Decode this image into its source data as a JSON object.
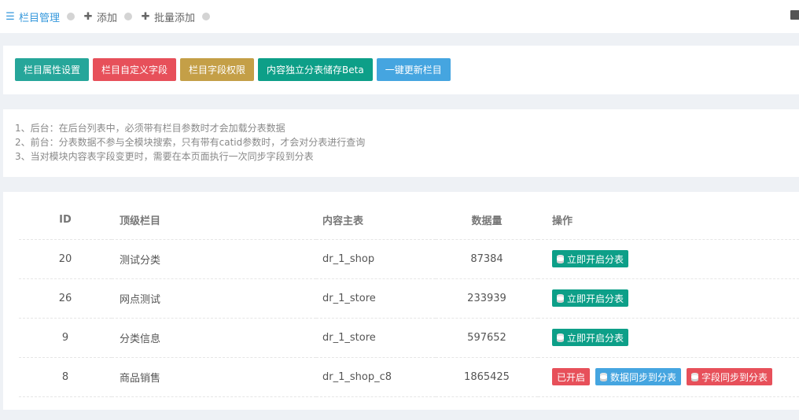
{
  "nav": {
    "items": [
      {
        "icon": "list-icon",
        "glyph": "☰",
        "label": "栏目管理"
      },
      {
        "icon": "plus-icon",
        "glyph": "✚",
        "label": "添加"
      },
      {
        "icon": "plus-icon",
        "glyph": "✚",
        "label": "批量添加"
      }
    ],
    "accent": "#3598dc"
  },
  "actions": {
    "attr_settings": "栏目属性设置",
    "custom_fields": "栏目自定义字段",
    "field_permissions": "栏目字段权限",
    "independent_storage": "内容独立分表储存Beta",
    "one_click_update": "一键更新栏目"
  },
  "notes": [
    "1、后台：在后台列表中，必须带有栏目参数时才会加载分表数据",
    "2、前台：分表数据不参与全模块搜索，只有带有catid参数时，才会对分表进行查询",
    "3、当对模块内容表字段变更时，需要在本页面执行一次同步字段到分表"
  ],
  "table": {
    "headers": {
      "id": "ID",
      "top": "顶级栏目",
      "main": "内容主表",
      "count": "数据量",
      "op": "操作"
    },
    "rows": [
      {
        "id": "20",
        "top": "测试分类",
        "main": "dr_1_shop",
        "count": "87384",
        "btn": "立即开启分表"
      },
      {
        "id": "26",
        "top": "网点测试",
        "main": "dr_1_store",
        "count": "233939",
        "btn": "立即开启分表"
      },
      {
        "id": "9",
        "top": "分类信息",
        "main": "dr_1_store",
        "count": "597652",
        "btn": "立即开启分表"
      },
      {
        "id": "8",
        "top": "商品销售",
        "main": "dr_1_shop_c8",
        "count": "1865425",
        "enabled": "已开启",
        "sync_data": "数据同步到分表",
        "sync_fields": "字段同步到分表"
      }
    ]
  }
}
